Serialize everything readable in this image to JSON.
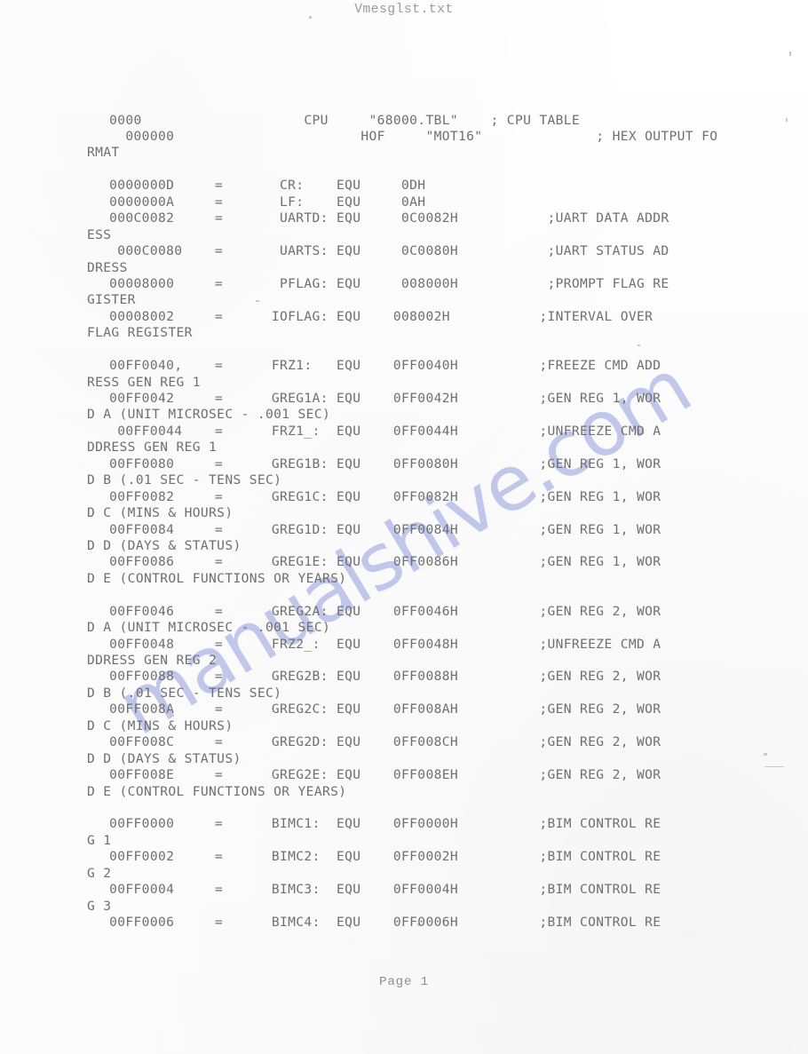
{
  "document": {
    "header_title": "Vmesglst.txt",
    "footer": "Page 1",
    "watermark": "manualshive.com",
    "watermark_color": "#b7bfe8",
    "text_color": "#6f6f6f",
    "page_background": "#ffffff"
  },
  "listing": {
    "lines": [
      {
        "id": "l01",
        "type": "code",
        "text": " 0000                    CPU     \"68000.TBL\"    ; CPU TABLE"
      },
      {
        "id": "l02",
        "type": "code",
        "text": "   000000                       HOF     \"MOT16\"              ; HEX OUTPUT FO"
      },
      {
        "id": "l03",
        "type": "cont",
        "text": "RMAT"
      },
      {
        "id": "l04",
        "type": "blank",
        "text": ""
      },
      {
        "id": "l05",
        "type": "code",
        "text": " 0000000D     =       CR:    EQU     0DH"
      },
      {
        "id": "l06",
        "type": "code",
        "text": " 0000000A     =       LF:    EQU     0AH"
      },
      {
        "id": "l07",
        "type": "code",
        "text": " 000C0082     =       UARTD: EQU     0C0082H           ;UART DATA ADDR"
      },
      {
        "id": "l08",
        "type": "cont",
        "text": "ESS"
      },
      {
        "id": "l09",
        "type": "code",
        "text": "  000C0080    =       UARTS: EQU     0C0080H           ;UART STATUS AD"
      },
      {
        "id": "l10",
        "type": "cont",
        "text": "DRESS"
      },
      {
        "id": "l11",
        "type": "code",
        "text": " 00008000     =       PFLAG: EQU     008000H           ;PROMPT FLAG RE"
      },
      {
        "id": "l12",
        "type": "cont",
        "text": "GISTER"
      },
      {
        "id": "l13",
        "type": "code",
        "text": " 00008002     =      IOFLAG: EQU    008002H           ;INTERVAL OVER"
      },
      {
        "id": "l14",
        "type": "cont",
        "text": "FLAG REGISTER"
      },
      {
        "id": "l15",
        "type": "blank",
        "text": ""
      },
      {
        "id": "l16",
        "type": "code",
        "text": " 00FF0040,    =      FRZ1:   EQU    0FF0040H          ;FREEZE CMD ADD"
      },
      {
        "id": "l17",
        "type": "cont",
        "text": "RESS GEN REG 1"
      },
      {
        "id": "l18",
        "type": "code",
        "text": " 00FF0042     =      GREG1A: EQU    0FF0042H          ;GEN REG 1, WOR"
      },
      {
        "id": "l19",
        "type": "cont",
        "text": "D A (UNIT MICROSEC - .001 SEC)"
      },
      {
        "id": "l20",
        "type": "code",
        "text": "  00FF0044    =      FRZ1_:  EQU    0FF0044H          ;UNFREEZE CMD A"
      },
      {
        "id": "l21",
        "type": "cont",
        "text": "DDRESS GEN REG 1"
      },
      {
        "id": "l22",
        "type": "code",
        "text": " 00FF0080     =      GREG1B: EQU    0FF0080H          ;GEN REG 1, WOR"
      },
      {
        "id": "l23",
        "type": "cont",
        "text": "D B (.01 SEC - TENS SEC)"
      },
      {
        "id": "l24",
        "type": "code",
        "text": " 00FF0082     =      GREG1C: EQU    0FF0082H          ;GEN REG 1, WOR"
      },
      {
        "id": "l25",
        "type": "cont",
        "text": "D C (MINS & HOURS)"
      },
      {
        "id": "l26",
        "type": "code",
        "text": " 00FF0084     =      GREG1D: EQU    0FF0084H          ;GEN REG 1, WOR"
      },
      {
        "id": "l27",
        "type": "cont",
        "text": "D D (DAYS & STATUS)"
      },
      {
        "id": "l28",
        "type": "code",
        "text": " 00FF0086     =      GREG1E: EQU    0FF0086H          ;GEN REG 1, WOR"
      },
      {
        "id": "l29",
        "type": "cont",
        "text": "D E (CONTROL FUNCTIONS OR YEARS)"
      },
      {
        "id": "l30",
        "type": "blank",
        "text": ""
      },
      {
        "id": "l31",
        "type": "code",
        "text": " 00FF0046     =      GREG2A: EQU    0FF0046H          ;GEN REG 2, WOR"
      },
      {
        "id": "l32",
        "type": "cont",
        "text": "D A (UNIT MICROSEC - .001 SEC)"
      },
      {
        "id": "l33",
        "type": "code",
        "text": " 00FF0048     =      FRZ2_:  EQU    0FF0048H          ;UNFREEZE CMD A"
      },
      {
        "id": "l34",
        "type": "cont",
        "text": "DDRESS GEN REG 2"
      },
      {
        "id": "l35",
        "type": "code",
        "text": " 00FF0088     =      GREG2B: EQU    0FF0088H          ;GEN REG 2, WOR"
      },
      {
        "id": "l36",
        "type": "cont",
        "text": "D B (.01 SEC - TENS SEC)"
      },
      {
        "id": "l37",
        "type": "code",
        "text": " 00FF008A     =      GREG2C: EQU    0FF008AH          ;GEN REG 2, WOR"
      },
      {
        "id": "l38",
        "type": "cont",
        "text": "D C (MINS & HOURS)"
      },
      {
        "id": "l39",
        "type": "code",
        "text": " 00FF008C     =      GREG2D: EQU    0FF008CH          ;GEN REG 2, WOR"
      },
      {
        "id": "l40",
        "type": "cont",
        "text": "D D (DAYS & STATUS)"
      },
      {
        "id": "l41",
        "type": "code",
        "text": " 00FF008E     =      GREG2E: EQU    0FF008EH          ;GEN REG 2, WOR"
      },
      {
        "id": "l42",
        "type": "cont",
        "text": "D E (CONTROL FUNCTIONS OR YEARS)"
      },
      {
        "id": "l43",
        "type": "blank",
        "text": ""
      },
      {
        "id": "l44",
        "type": "code",
        "text": " 00FF0000     =      BIMC1:  EQU    0FF0000H          ;BIM CONTROL RE"
      },
      {
        "id": "l45",
        "type": "cont",
        "text": "G 1"
      },
      {
        "id": "l46",
        "type": "code",
        "text": " 00FF0002     =      BIMC2:  EQU    0FF0002H          ;BIM CONTROL RE"
      },
      {
        "id": "l47",
        "type": "cont",
        "text": "G 2"
      },
      {
        "id": "l48",
        "type": "code",
        "text": " 00FF0004     =      BIMC3:  EQU    0FF0004H          ;BIM CONTROL RE"
      },
      {
        "id": "l49",
        "type": "cont",
        "text": "G 3"
      },
      {
        "id": "l50",
        "type": "code",
        "text": " 00FF0006     =      BIMC4:  EQU    0FF0006H          ;BIM CONTROL RE"
      }
    ]
  }
}
